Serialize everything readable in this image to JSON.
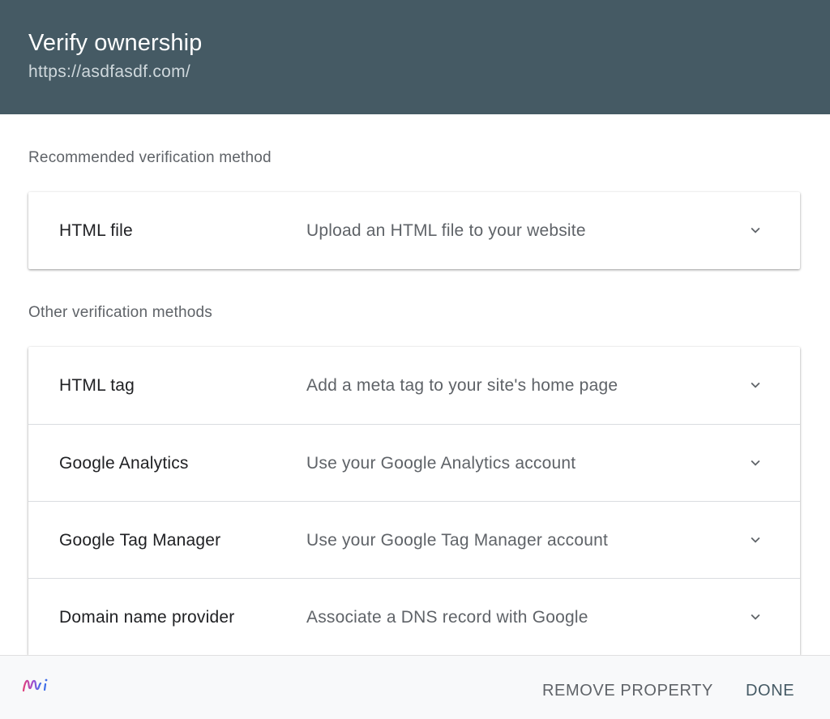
{
  "header": {
    "title": "Verify ownership",
    "subtitle": "https://asdfasdf.com/"
  },
  "recommended": {
    "label": "Recommended verification method",
    "methods": [
      {
        "name": "HTML file",
        "description": "Upload an HTML file to your website"
      }
    ]
  },
  "other": {
    "label": "Other verification methods",
    "methods": [
      {
        "name": "HTML tag",
        "description": "Add a meta tag to your site's home page"
      },
      {
        "name": "Google Analytics",
        "description": "Use your Google Analytics account"
      },
      {
        "name": "Google Tag Manager",
        "description": "Use your Google Tag Manager account"
      },
      {
        "name": "Domain name provider",
        "description": "Associate a DNS record with Google"
      }
    ]
  },
  "footer": {
    "remove_label": "REMOVE PROPERTY",
    "done_label": "DONE",
    "logo_icon": "mi-logo-icon"
  },
  "colors": {
    "header_bg": "#455a64",
    "accent": "#455a64"
  },
  "icons": {
    "expand": "chevron-down-icon"
  }
}
